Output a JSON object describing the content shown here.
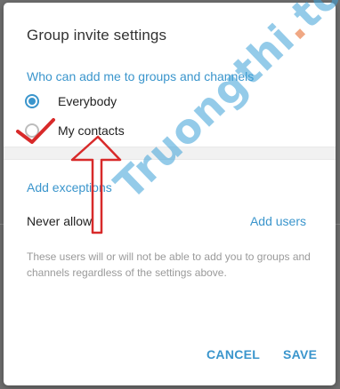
{
  "dialog": {
    "title": "Group invite settings",
    "section_label": "Who can add me to groups and channels",
    "options": [
      {
        "label": "Everybody",
        "selected": true
      },
      {
        "label": "My contacts",
        "selected": false
      }
    ],
    "exceptions_label": "Add exceptions",
    "never_allow_label": "Never allow",
    "add_users_label": "Add users",
    "note": "These users will or will not be able to add you to groups and channels regardless of the settings above.",
    "cancel_label": "CANCEL",
    "save_label": "SAVE"
  },
  "watermark": {
    "name": "Truongthi",
    "dot": ".",
    "tld": "top"
  },
  "colors": {
    "accent": "#3a95cc",
    "annotation": "#d82a2a"
  }
}
